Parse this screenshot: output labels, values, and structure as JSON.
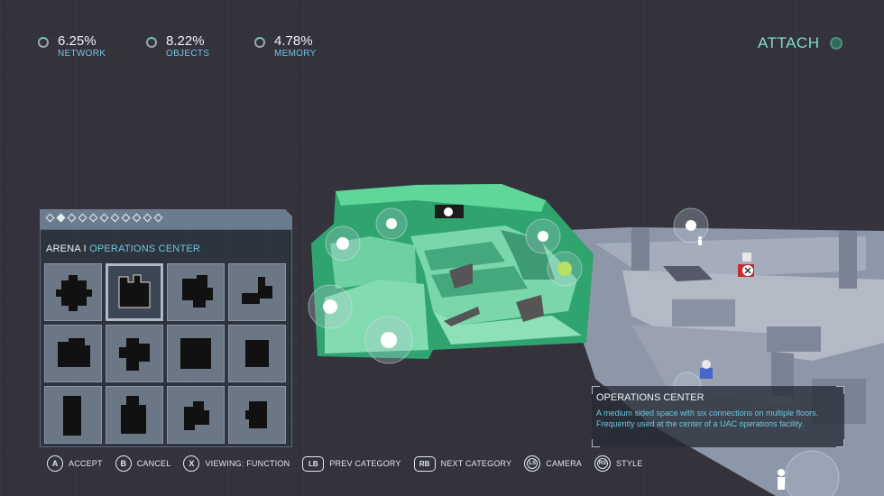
{
  "stats": [
    {
      "value": "6.25%",
      "label": "NETWORK"
    },
    {
      "value": "8.22%",
      "label": "OBJECTS"
    },
    {
      "value": "4.78%",
      "label": "MEMORY"
    }
  ],
  "attach": {
    "label": "ATTACH"
  },
  "panel": {
    "title": "ARENA I ",
    "subtitle": "OPERATIONS CENTER",
    "pager_count": 11,
    "pager_active": 1,
    "tiles": [
      "tile-1",
      "tile-2",
      "tile-3",
      "tile-4",
      "tile-5",
      "tile-6",
      "tile-7",
      "tile-8",
      "tile-9",
      "tile-10",
      "tile-11",
      "tile-12"
    ],
    "selected_tile": 1
  },
  "info": {
    "title": "OPERATIONS CENTER",
    "description": "A medium sided space with six connections on multiple floors. Frequently used at the center of a UAC operations facility."
  },
  "controls": [
    {
      "key": "A",
      "label": "ACCEPT",
      "style": "round"
    },
    {
      "key": "B",
      "label": "CANCEL",
      "style": "round"
    },
    {
      "key": "X",
      "label": "VIEWING: FUNCTION",
      "style": "round"
    },
    {
      "key": "LB",
      "label": "PREV CATEGORY",
      "style": "rect"
    },
    {
      "key": "RB",
      "label": "NEXT CATEGORY",
      "style": "rect"
    },
    {
      "key": "LS",
      "label": "CAMERA",
      "style": "stick"
    },
    {
      "key": "RS",
      "label": "STYLE",
      "style": "stick"
    }
  ],
  "colors": {
    "background": "#34323b",
    "room_highlight": "#4fc08d",
    "accent_text": "#6ec6e0",
    "attach_text": "#7fe0c2"
  }
}
